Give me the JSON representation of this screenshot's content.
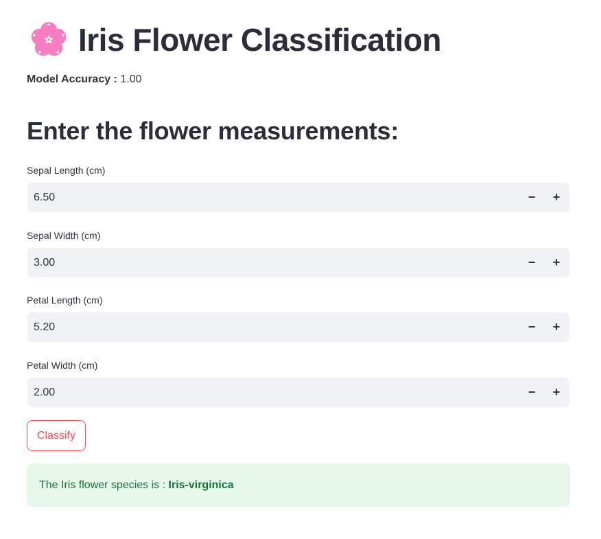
{
  "header": {
    "icon": "cherry-blossom-icon",
    "title": "Iris Flower Classification"
  },
  "accuracy": {
    "label": "Model Accuracy :",
    "value": "1.00"
  },
  "form": {
    "heading": "Enter the flower measurements:",
    "fields": [
      {
        "label": "Sepal Length (cm)",
        "value": "6.50"
      },
      {
        "label": "Sepal Width (cm)",
        "value": "3.00"
      },
      {
        "label": "Petal Length (cm)",
        "value": "5.20"
      },
      {
        "label": "Petal Width (cm)",
        "value": "2.00"
      }
    ],
    "decrement_symbol": "−",
    "increment_symbol": "+",
    "classify_label": "Classify"
  },
  "result": {
    "prefix": "The Iris flower species is :",
    "species": "Iris-virginica"
  },
  "colors": {
    "accent": "#ff4b4b",
    "input_bg": "#f0f2f6",
    "success_bg": "#e7f8ea",
    "success_text": "#177233",
    "flower_pink": "#f77dc3"
  }
}
